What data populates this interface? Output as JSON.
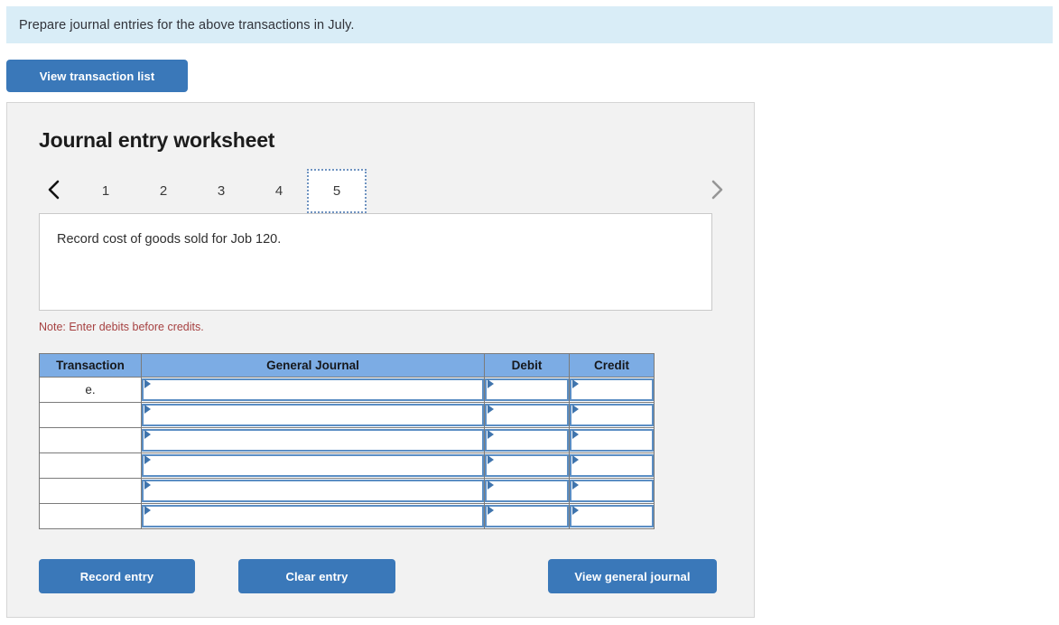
{
  "banner": {
    "instruction": "Prepare journal entries for the above transactions in July."
  },
  "toolbar": {
    "view_transaction_list_label": "View transaction list"
  },
  "worksheet": {
    "title": "Journal entry worksheet",
    "prev_icon": "chevron-left-icon",
    "next_icon": "chevron-right-icon",
    "tabs": [
      {
        "label": "1",
        "active": false
      },
      {
        "label": "2",
        "active": false
      },
      {
        "label": "3",
        "active": false
      },
      {
        "label": "4",
        "active": false
      },
      {
        "label": "5",
        "active": true
      }
    ],
    "description": "Record cost of goods sold for Job 120.",
    "note": "Note: Enter debits before credits."
  },
  "table": {
    "headers": {
      "transaction": "Transaction",
      "general_journal": "General Journal",
      "debit": "Debit",
      "credit": "Credit"
    },
    "rows": [
      {
        "transaction": "e.",
        "general_journal": "",
        "debit": "",
        "credit": ""
      },
      {
        "transaction": "",
        "general_journal": "",
        "debit": "",
        "credit": ""
      },
      {
        "transaction": "",
        "general_journal": "",
        "debit": "",
        "credit": ""
      },
      {
        "transaction": "",
        "general_journal": "",
        "debit": "",
        "credit": ""
      },
      {
        "transaction": "",
        "general_journal": "",
        "debit": "",
        "credit": ""
      },
      {
        "transaction": "",
        "general_journal": "",
        "debit": "",
        "credit": ""
      }
    ]
  },
  "footer": {
    "record_entry_label": "Record entry",
    "clear_entry_label": "Clear entry",
    "view_general_journal_label": "View general journal"
  },
  "colors": {
    "banner_bg": "#d9edf7",
    "button_blue": "#3a78b9",
    "table_header_blue": "#7cace4",
    "input_border_blue": "#5b8ec4",
    "note_red": "#a64141",
    "panel_bg": "#f2f2f2"
  }
}
